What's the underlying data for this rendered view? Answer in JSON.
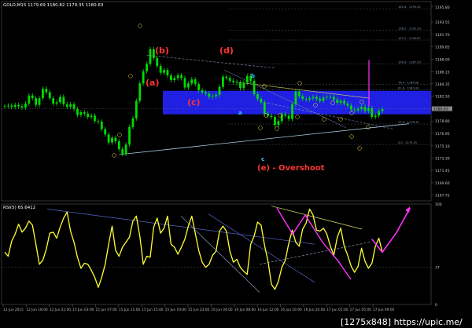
{
  "symbol_header": "GOLD,M15  1179.69 1180.82 1179.35 1180.63",
  "indicator_header": "RSI(5) 65.6412",
  "watermark": "[1275x848] https://upic.me/",
  "colors": {
    "background": "#000000",
    "candle": "#00dd00",
    "rsi_line": "#ffff33",
    "target_magenta": "#ff33ff",
    "zone_blue": "#2222ee",
    "trend_line": "#aaccdd",
    "wave_red": "#ff3333",
    "wave_cyan": "#33ccff",
    "wave_yellow": "#ffdd44",
    "grid": "#1e2a3a"
  },
  "wave_labels": {
    "a": "(a)",
    "b": "(b)",
    "c": "(c)",
    "d": "(d)",
    "e_overshoot": "(e) - Overshoot",
    "a_small": "a",
    "b_small": "b",
    "c_small": "c"
  },
  "rsi_axis": {
    "levels": [
      "100",
      "37",
      "0"
    ]
  },
  "chart_data": [
    {
      "type": "line",
      "title": "",
      "panel": "price",
      "y_ticks": [
        "1195.80",
        "1193.55",
        "1191.70",
        "1189.85",
        "1188.00",
        "1186.15",
        "1184.35",
        "1182.50",
        "1180.65",
        "1178.80",
        "1176.95",
        "1175.10",
        "1173.30",
        "1171.45",
        "1169.60",
        "1167.75"
      ],
      "fib_levels": [
        {
          "label": "161.8 - 1195.52",
          "value": 1195.52
        },
        {
          "label": "138.2 - 1192.33",
          "value": 1192.33
        },
        {
          "label": "127.2 - 1190.87",
          "value": 1190.87
        },
        {
          "label": "100.0 - 1187.29",
          "value": 1187.29
        },
        {
          "label": "76.4 - 1184.28",
          "value": 1184.28
        },
        {
          "label": "61.8 - 1183.43",
          "value": 1183.43
        },
        {
          "label": "50.0 - 1181.81",
          "value": 1181.81
        },
        {
          "label": "38.2 - 1180.26",
          "value": 1180.26
        },
        {
          "label": "23.6 - 1178.35",
          "value": 1178.35
        },
        {
          "label": "0.0 - 1175.31",
          "value": 1175.31
        }
      ],
      "current_price": {
        "label": "1180.63",
        "value": 1180.63
      },
      "ylim": [
        1166.9,
        1196.6
      ],
      "x_labels": [
        "12 Jun 2015",
        "12 Jun 18:00",
        "12 Jun 22:00",
        "15 Jun 03:00",
        "15 Jun 07:00",
        "15 Jun 11:00",
        "15 Jun 15:00",
        "15 Jun 19:00",
        "15 Jun 23:00",
        "16 Jun 04:00",
        "16 Jun 08:00",
        "16 Jun 12:00",
        "16 Jun 16:00",
        "16 Jun 20:00",
        "17 Jun 01:00",
        "17 Jun 05:00",
        "17 Jun 09:00"
      ],
      "close": [
        1181,
        1181.1,
        1180.9,
        1181.2,
        1181,
        1180.8,
        1181.4,
        1182.6,
        1182.2,
        1181.2,
        1182.2,
        1183.6,
        1183.1,
        1182.2,
        1181.4,
        1181.6,
        1182.4,
        1181.3,
        1180.9,
        1181.3,
        1180.6,
        1179.7,
        1180.1,
        1179.9,
        1179.4,
        1179.6,
        1178.8,
        1178.7,
        1177.6,
        1176.8,
        1175.6,
        1176.3,
        1175.8,
        1174.6,
        1173.9,
        1175.3,
        1177.9,
        1179.2,
        1181.8,
        1184.4,
        1186.2,
        1187.3,
        1189.5,
        1188.2,
        1187,
        1186,
        1186.4,
        1185.6,
        1184.9,
        1185.2,
        1185.6,
        1185.2,
        1183.8,
        1184.4,
        1185,
        1184.3,
        1183.4,
        1183.1,
        1182.9,
        1182.4,
        1182.5,
        1182.7,
        1183.9,
        1185.4,
        1185.2,
        1184.8,
        1184.6,
        1184.5,
        1183.7,
        1184.5,
        1185.5,
        1184.8,
        1182.8,
        1182.1,
        1181.6,
        1179.9,
        1179.6,
        1179.4,
        1178.2,
        1178.8,
        1179.8,
        1179.6,
        1179.1,
        1181.3,
        1183.2,
        1182.5,
        1182.1,
        1182,
        1182.2,
        1182.4,
        1182.1,
        1181.8,
        1182.3,
        1182.4,
        1182.4,
        1182,
        1181.5,
        1181.8,
        1181.4,
        1181.1,
        1180.5,
        1180.4,
        1180.6,
        1180.9,
        1180.3,
        1180.7,
        1179.4,
        1179.6,
        1180.3,
        1180.6
      ],
      "rsi": [
        52,
        48,
        63,
        70,
        80,
        72,
        76,
        83,
        79,
        60,
        40,
        44,
        55,
        71,
        72,
        66,
        77,
        86,
        92,
        73,
        62,
        47,
        36,
        41,
        40,
        34,
        27,
        17,
        27,
        40,
        60,
        78,
        54,
        48,
        57,
        62,
        67,
        83,
        88,
        68,
        40,
        48,
        47,
        77,
        86,
        71,
        76,
        88,
        60,
        57,
        50,
        57,
        65,
        78,
        88,
        71,
        54,
        42,
        37,
        40,
        49,
        53,
        73,
        78,
        73,
        53,
        42,
        45,
        37,
        33,
        30,
        60,
        68,
        82,
        79,
        59,
        43,
        20,
        15,
        23,
        37,
        44,
        61,
        74,
        62,
        58,
        75,
        81,
        95,
        89,
        74,
        73,
        76,
        70,
        58,
        49,
        67,
        76,
        58,
        49,
        38,
        32,
        38,
        56,
        43,
        36,
        41,
        58,
        66,
        52
      ],
      "rsi_projection": [
        [
          106,
          65
        ],
        [
          109,
          52
        ],
        [
          113,
          71
        ],
        [
          117,
          96
        ]
      ],
      "rsi_ylim": [
        0,
        100
      ]
    }
  ]
}
